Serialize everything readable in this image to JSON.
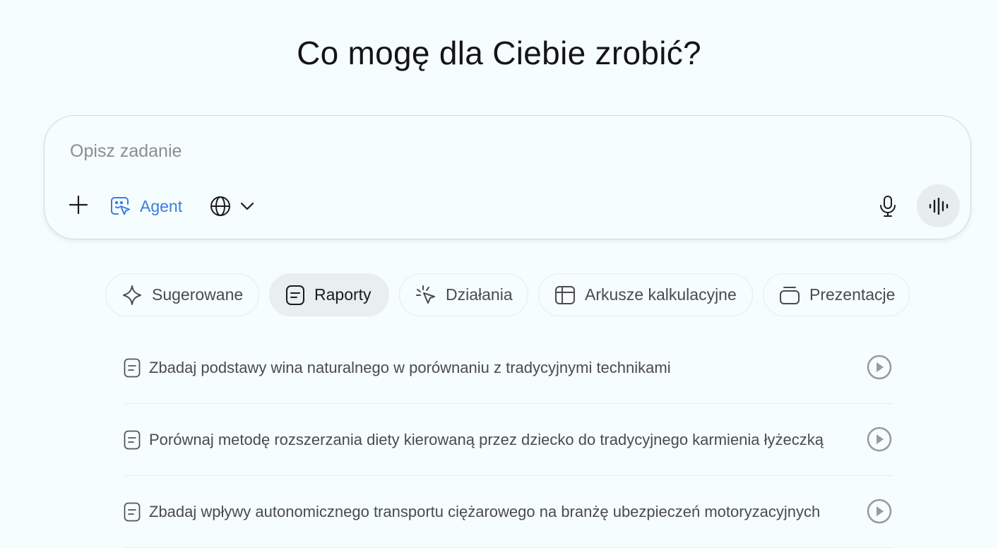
{
  "heading": "Co mogę dla Ciebie zrobić?",
  "composer": {
    "placeholder": "Opisz zadanie",
    "agent_label": "Agent",
    "accent": "#3b7de0"
  },
  "categories": [
    {
      "label": "Sugerowane",
      "icon": "sparkle-icon",
      "active": false
    },
    {
      "label": "Raporty",
      "icon": "document-icon",
      "active": true
    },
    {
      "label": "Działania",
      "icon": "click-cursor-icon",
      "active": false
    },
    {
      "label": "Arkusze kalkulacyjne",
      "icon": "spreadsheet-icon",
      "active": false
    },
    {
      "label": "Prezentacje",
      "icon": "slides-icon",
      "active": false
    }
  ],
  "suggestions": [
    {
      "text": "Zbadaj podstawy wina naturalnego w porównaniu z tradycyjnymi technikami"
    },
    {
      "text": "Porównaj metodę rozszerzania diety kierowaną przez dziecko do tradycyjnego karmienia łyżeczką"
    },
    {
      "text": "Zbadaj wpływy autonomicznego transportu ciężarowego na branżę ubezpieczeń motoryzacyjnych"
    }
  ]
}
